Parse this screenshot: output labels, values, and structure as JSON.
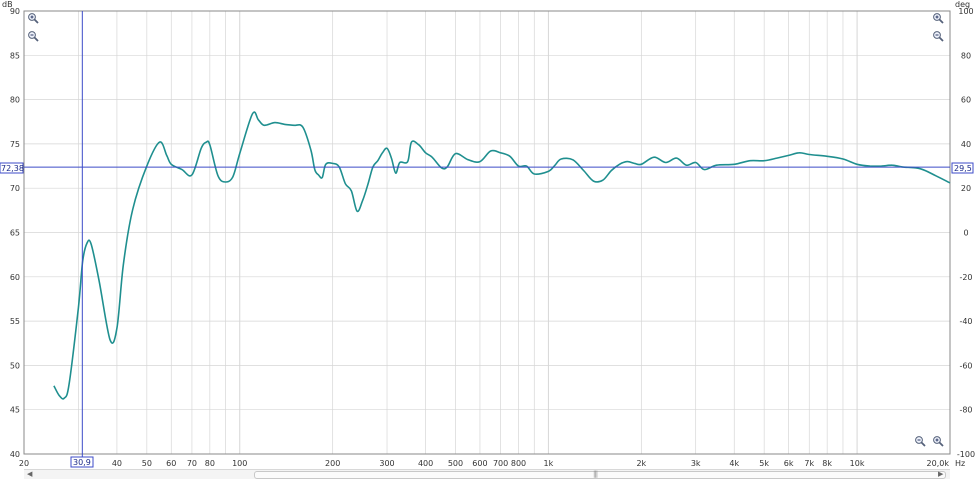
{
  "colors": {
    "trace": "#1f8f8f",
    "cursor": "#3c4bc8",
    "grid": "#d6d6d6",
    "frame": "#8a8a8a"
  },
  "units": {
    "left": "dB",
    "right": "deg",
    "x": "Hz"
  },
  "cursor": {
    "x_label": "30,9",
    "y_left_label": "72,38",
    "y_right_label": "29,5",
    "x_value": 30.9,
    "y_value": 72.38
  },
  "icons": {
    "zoom_in_top_left": "zoom-in-icon",
    "zoom_out_top_left": "zoom-out-icon",
    "zoom_in_top_right": "zoom-in-icon",
    "zoom_out_top_right": "zoom-out-icon",
    "zoom_out_bottom_1": "zoom-out-icon",
    "zoom_in_bottom_2": "zoom-in-icon",
    "scroll_left": "scroll-left-icon",
    "scroll_right": "scroll-right-icon",
    "scroll_grip": "grip-icon"
  },
  "chart_data": {
    "type": "line",
    "x_scale": "log",
    "xlim": [
      20,
      20000
    ],
    "ylim": [
      40,
      90
    ],
    "ylim_right": [
      -100,
      100
    ],
    "grid": true,
    "y_ticks": [
      40,
      45,
      50,
      55,
      60,
      65,
      70,
      75,
      80,
      85,
      90
    ],
    "y_tick_labels": [
      "40",
      "45",
      "50",
      "55",
      "60",
      "65",
      "70",
      "75",
      "80",
      "85",
      "90"
    ],
    "y_right_ticks": [
      -100,
      -80,
      -60,
      -40,
      -20,
      0,
      20,
      40,
      60,
      80,
      100
    ],
    "y_right_tick_labels": [
      "-100",
      "-80",
      "-60",
      "-40",
      "-20",
      "0",
      "20",
      "40",
      "60",
      "80",
      "100"
    ],
    "x_ticks": [
      20,
      40,
      50,
      60,
      70,
      80,
      100,
      200,
      300,
      400,
      500,
      600,
      700,
      800,
      1000,
      2000,
      3000,
      4000,
      5000,
      6000,
      7000,
      8000,
      10000,
      20000
    ],
    "x_tick_labels": [
      "20",
      "40",
      "50",
      "60",
      "70",
      "80",
      "100",
      "200",
      "300",
      "400",
      "500",
      "600",
      "700",
      "800",
      "1k",
      "2k",
      "3k",
      "4k",
      "5k",
      "6k",
      "7k",
      "8k",
      "10k",
      "20,0k"
    ],
    "series": [
      {
        "x": [
          25,
          26,
          27,
          28,
          30,
          31,
          32,
          33,
          35,
          38,
          40,
          42,
          45,
          50,
          55,
          58,
          60,
          65,
          70,
          75,
          78,
          80,
          85,
          90,
          95,
          100,
          110,
          115,
          120,
          130,
          140,
          150,
          160,
          170,
          175,
          180,
          185,
          190,
          200,
          210,
          220,
          230,
          240,
          250,
          260,
          270,
          280,
          290,
          300,
          310,
          320,
          330,
          350,
          360,
          380,
          400,
          420,
          450,
          470,
          500,
          550,
          600,
          650,
          700,
          750,
          800,
          850,
          900,
          1000,
          1050,
          1100,
          1200,
          1300,
          1400,
          1500,
          1600,
          1700,
          1800,
          1900,
          2000,
          2200,
          2400,
          2600,
          2800,
          3000,
          3200,
          3500,
          4000,
          4500,
          5000,
          5500,
          6000,
          6500,
          7000,
          8000,
          9000,
          10000,
          11000,
          12000,
          13000,
          14000,
          16000,
          18000,
          20000
        ],
        "y": [
          47.7,
          46.6,
          46.3,
          47.9,
          56.5,
          61.8,
          63.8,
          63.7,
          59.6,
          52.9,
          54.2,
          61.5,
          67.6,
          72.5,
          75.2,
          73.7,
          72.7,
          72.1,
          71.5,
          74.5,
          75.2,
          74.9,
          71.4,
          70.7,
          71.3,
          73.9,
          78.4,
          77.7,
          77.1,
          77.4,
          77.2,
          77.1,
          76.9,
          74.3,
          72.1,
          71.5,
          71.2,
          72.7,
          72.8,
          72.4,
          70.5,
          69.7,
          67.4,
          68.6,
          70.4,
          72.4,
          73.1,
          74.0,
          74.5,
          73.4,
          71.7,
          72.9,
          73.0,
          75.2,
          74.9,
          74.0,
          73.5,
          72.3,
          72.4,
          73.9,
          73.2,
          73.0,
          74.2,
          74.0,
          73.6,
          72.5,
          72.5,
          71.6,
          71.9,
          72.6,
          73.3,
          73.2,
          72.0,
          70.8,
          70.9,
          72.0,
          72.7,
          73.0,
          72.8,
          72.7,
          73.5,
          72.9,
          73.4,
          72.6,
          72.9,
          72.1,
          72.6,
          72.7,
          73.1,
          73.1,
          73.4,
          73.7,
          74.0,
          73.8,
          73.6,
          73.3,
          72.7,
          72.5,
          72.5,
          72.6,
          72.4,
          72.2,
          71.4,
          70.6
        ]
      }
    ]
  }
}
